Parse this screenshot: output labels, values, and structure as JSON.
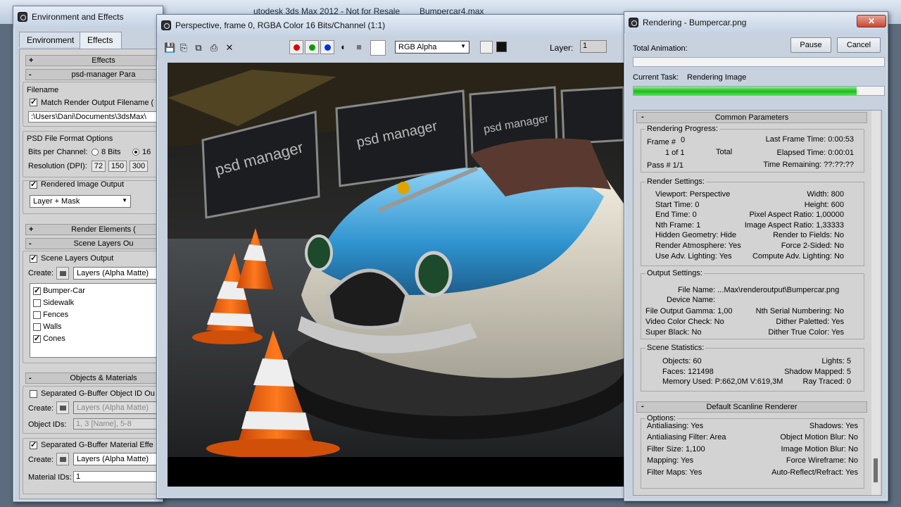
{
  "max": {
    "title": "utodesk 3ds Max 2012 - Not for Resale",
    "file": "Bumpercar4.max"
  },
  "env": {
    "title": "Environment and Effects",
    "tabs": [
      "Environment",
      "Effects"
    ],
    "effects_rollout": "Effects",
    "psd_rollout": "psd-manager Para",
    "filename_group": "Filename",
    "match_render": "Match Render Output Filename (",
    "path_value": ":\\Users\\Dani\\Documents\\3dsMax\\",
    "psd_format_group": "PSD File Format Options",
    "bits_label": "Bits per Channel:",
    "bits_8": "8 Bits",
    "bits_16": "16",
    "dpi_label": "Resolution (DPI):",
    "dpi": [
      "72",
      "150",
      "300"
    ],
    "rendered_image_output": "Rendered Image Output",
    "layer_mask": "Layer + Mask",
    "render_elements": "Render Elements (",
    "scene_layers_rollout": "Scene Layers Ou",
    "scene_layers_output": "Scene Layers Output",
    "create_label": "Create:",
    "layers_alpha": "Layers (Alpha Matte)",
    "layers": [
      {
        "name": "Bumper-Car",
        "checked": true
      },
      {
        "name": "Sidewalk",
        "checked": false
      },
      {
        "name": "Fences",
        "checked": false
      },
      {
        "name": "Walls",
        "checked": false
      },
      {
        "name": "Cones",
        "checked": true
      }
    ],
    "objects_rollout": "Objects & Materials",
    "gbuffer_object": "Separated G-Buffer Object ID Ou",
    "object_ids_label": "Object IDs:",
    "object_ids_value": "1, 3 [Name], 5-8",
    "gbuffer_material": "Separated G-Buffer Material Effe",
    "material_ids_label": "Material IDs:",
    "material_ids_value": "1"
  },
  "vfb": {
    "title": "Perspective, frame 0, RGBA Color 16 Bits/Channel (1:1)",
    "channel": "RGB Alpha",
    "layer_label": "Layer:",
    "layer_value": "1",
    "banner_text": "psd manager"
  },
  "render": {
    "title": "Rendering - Bumpercar.png",
    "pause": "Pause",
    "cancel": "Cancel",
    "total_animation": "Total Animation:",
    "total_progress": 0,
    "current_task_label": "Current Task:",
    "current_task": "Rendering Image",
    "task_progress": 0.89,
    "common_params": "Common Parameters",
    "progress_group": "Rendering Progress:",
    "frame_label": "Frame #",
    "frame_value": "0",
    "last_frame": "Last Frame Time:  0:00:53",
    "one_of_one": "1 of 1",
    "total": "Total",
    "elapsed": "Elapsed Time:  0:00:01",
    "pass": "Pass #  1/1",
    "remaining": "Time Remaining:  ??:??:??",
    "render_settings": "Render Settings:",
    "rs_left": [
      [
        "Viewport:",
        "Perspective"
      ],
      [
        "Start Time:",
        "0"
      ],
      [
        "End Time:",
        "0"
      ],
      [
        "Nth Frame:",
        "1"
      ],
      [
        "Hidden Geometry:",
        "Hide"
      ],
      [
        "Render Atmosphere:",
        "Yes"
      ],
      [
        "Use Adv. Lighting:",
        "Yes"
      ]
    ],
    "rs_right": [
      [
        "Width:",
        "800"
      ],
      [
        "Height:",
        "600"
      ],
      [
        "Pixel Aspect Ratio:",
        "1,00000"
      ],
      [
        "Image Aspect Ratio:",
        "1,33333"
      ],
      [
        "Render to Fields:",
        "No"
      ],
      [
        "Force 2-Sided:",
        "No"
      ],
      [
        "Compute Adv. Lighting:",
        "No"
      ]
    ],
    "output_settings": "Output Settings:",
    "file_name": "File Name:  ...Max\\renderoutput\\Bumpercar.png",
    "device_name": "Device Name:",
    "os_left": [
      [
        "File Output Gamma:",
        "1,00"
      ],
      [
        "Video Color Check:",
        "No"
      ],
      [
        "Super Black:",
        "No"
      ]
    ],
    "os_right": [
      [
        "Nth Serial Numbering:",
        "No"
      ],
      [
        "Dither Paletted:",
        "Yes"
      ],
      [
        "Dither True Color:",
        "Yes"
      ]
    ],
    "scene_stats": "Scene Statistics:",
    "ss_left": [
      [
        "Objects:",
        "60"
      ],
      [
        "Faces:",
        "121498"
      ],
      [
        "Memory Used:",
        "P:662,0M V:619,3M"
      ]
    ],
    "ss_right": [
      [
        "Lights:",
        "5"
      ],
      [
        "Shadow Mapped:",
        "5"
      ],
      [
        "Ray Traced:",
        "0"
      ]
    ],
    "scanline": "Default Scanline Renderer",
    "options": "Options:",
    "op_left": [
      [
        "Antialiasing:",
        "Yes"
      ],
      [
        "Antialiasing Filter:",
        "Area"
      ],
      [
        "Filter Size:",
        "1,100"
      ],
      [
        "Mapping:",
        "Yes"
      ],
      [
        "Filter Maps:",
        "Yes"
      ]
    ],
    "op_right": [
      [
        "Shadows:",
        "Yes"
      ],
      [
        "Object Motion Blur:",
        "No"
      ],
      [
        "Image Motion Blur:",
        "No"
      ],
      [
        "Force Wireframe:",
        "No"
      ],
      [
        "Auto-Reflect/Refract:",
        "Yes"
      ]
    ]
  }
}
